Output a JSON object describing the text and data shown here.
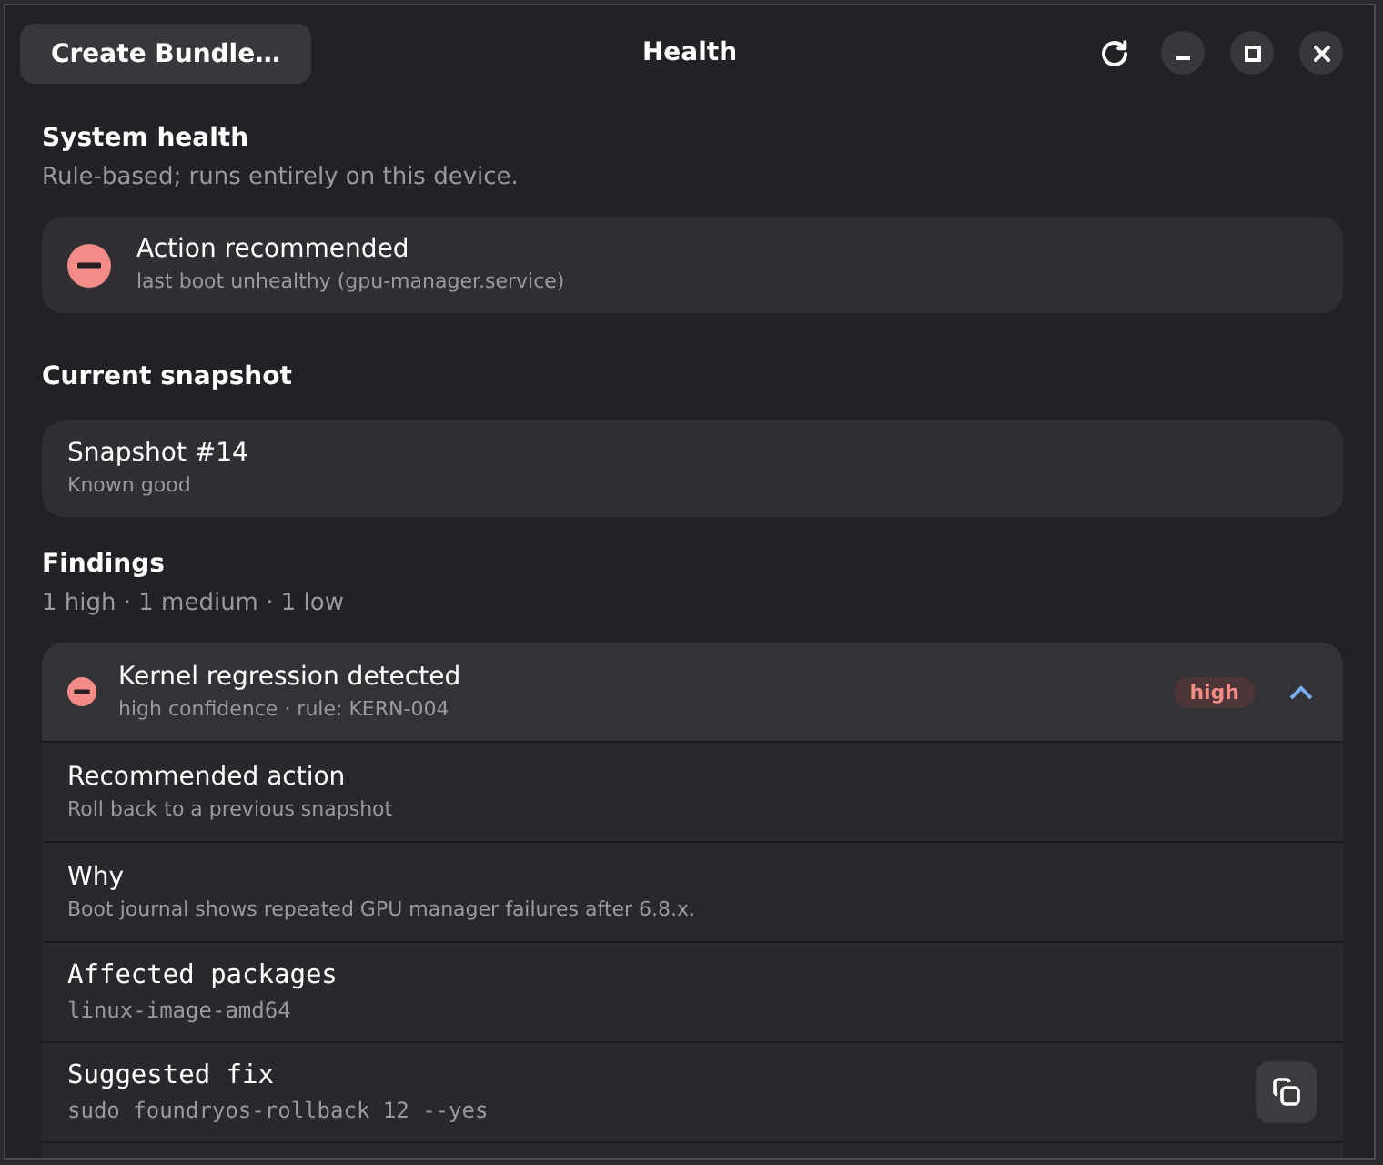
{
  "window": {
    "title": "Health",
    "bundle_button": "Create Bundle…"
  },
  "system_health": {
    "heading": "System health",
    "description": "Rule-based; runs entirely on this device.",
    "status": {
      "kind": "error",
      "title": "Action recommended",
      "detail": "last boot unhealthy (gpu-manager.service)"
    }
  },
  "current_snapshot": {
    "heading": "Current snapshot",
    "title": "Snapshot #14",
    "detail": "Known good"
  },
  "findings": {
    "heading": "Findings",
    "summary": "1 high · 1 medium · 1 low",
    "items": [
      {
        "kind": "error",
        "title": "Kernel regression detected",
        "detail": "high confidence · rule: KERN-004",
        "severity": "high",
        "expanded": true,
        "rows": [
          {
            "kind": "text",
            "label": "Recommended action",
            "value": "Roll back to a previous snapshot"
          },
          {
            "kind": "text",
            "label": "Why",
            "value": "Boot journal shows repeated GPU manager failures after 6.8.x."
          },
          {
            "kind": "code",
            "label": "Affected packages",
            "value": "linux-image-amd64"
          },
          {
            "kind": "code",
            "label": "Suggested fix",
            "value": "sudo foundryos-rollback 12 --yes",
            "copyable": true
          }
        ]
      }
    ]
  }
}
